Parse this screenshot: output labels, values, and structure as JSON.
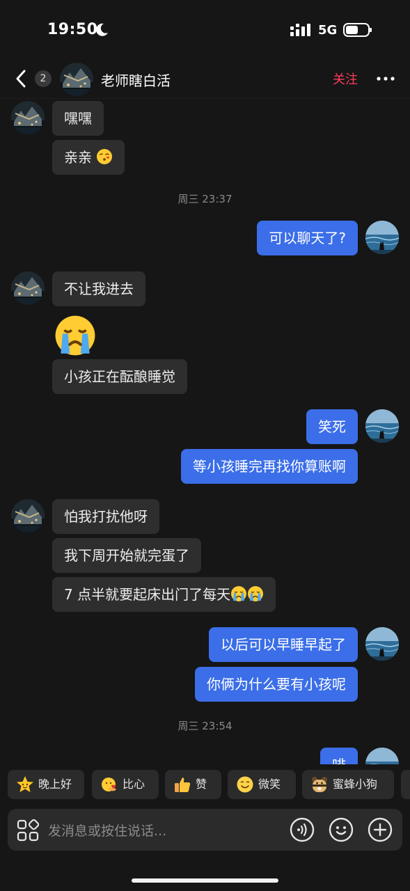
{
  "status_bar": {
    "time": "19:50",
    "network": "5G"
  },
  "header": {
    "unread_count": "2",
    "title": "老师瞎白活",
    "follow_label": "关注"
  },
  "messages": [
    {
      "side": "in",
      "text": "嘿嘿"
    },
    {
      "side": "in",
      "text": "亲亲",
      "emoji": "kissing-face"
    },
    {
      "type": "time",
      "text": "周三 23:37"
    },
    {
      "side": "out",
      "text": "可以聊天了?"
    },
    {
      "side": "in",
      "text": "不让我进去"
    },
    {
      "side": "in",
      "emoji": "loudly-crying-face"
    },
    {
      "side": "in",
      "text": "小孩正在酝酿睡觉"
    },
    {
      "side": "out",
      "text": "笑死"
    },
    {
      "side": "out",
      "text": "等小孩睡完再找你算账啊"
    },
    {
      "side": "in",
      "text": "怕我打扰他呀"
    },
    {
      "side": "in",
      "text": "我下周开始就完蛋了"
    },
    {
      "side": "in",
      "text": "7 点半就要起床出门了每天",
      "emoji": "loudly-crying-face"
    },
    {
      "side": "out",
      "text": "以后可以早睡早起了"
    },
    {
      "side": "out",
      "text": "你俩为什么要有小孩呢"
    },
    {
      "type": "time",
      "text": "周三 23:54"
    },
    {
      "side": "out",
      "text": "啡",
      "partial": true
    }
  ],
  "quick_replies": [
    {
      "icon": "star-face-icon",
      "label": "晚上好"
    },
    {
      "icon": "heart-hands-icon",
      "label": "比心"
    },
    {
      "icon": "thumbs-up-icon",
      "label": "赞"
    },
    {
      "icon": "smile-icon",
      "label": "微笑"
    },
    {
      "icon": "bee-dog-icon",
      "label": "蜜蜂小狗"
    }
  ],
  "input": {
    "placeholder": "发消息或按住说话..."
  },
  "colors": {
    "background": "#161616",
    "incoming_bubble": "#2E2E2E",
    "outgoing_bubble": "#3B6EE8",
    "follow": "#FF3B5C"
  }
}
